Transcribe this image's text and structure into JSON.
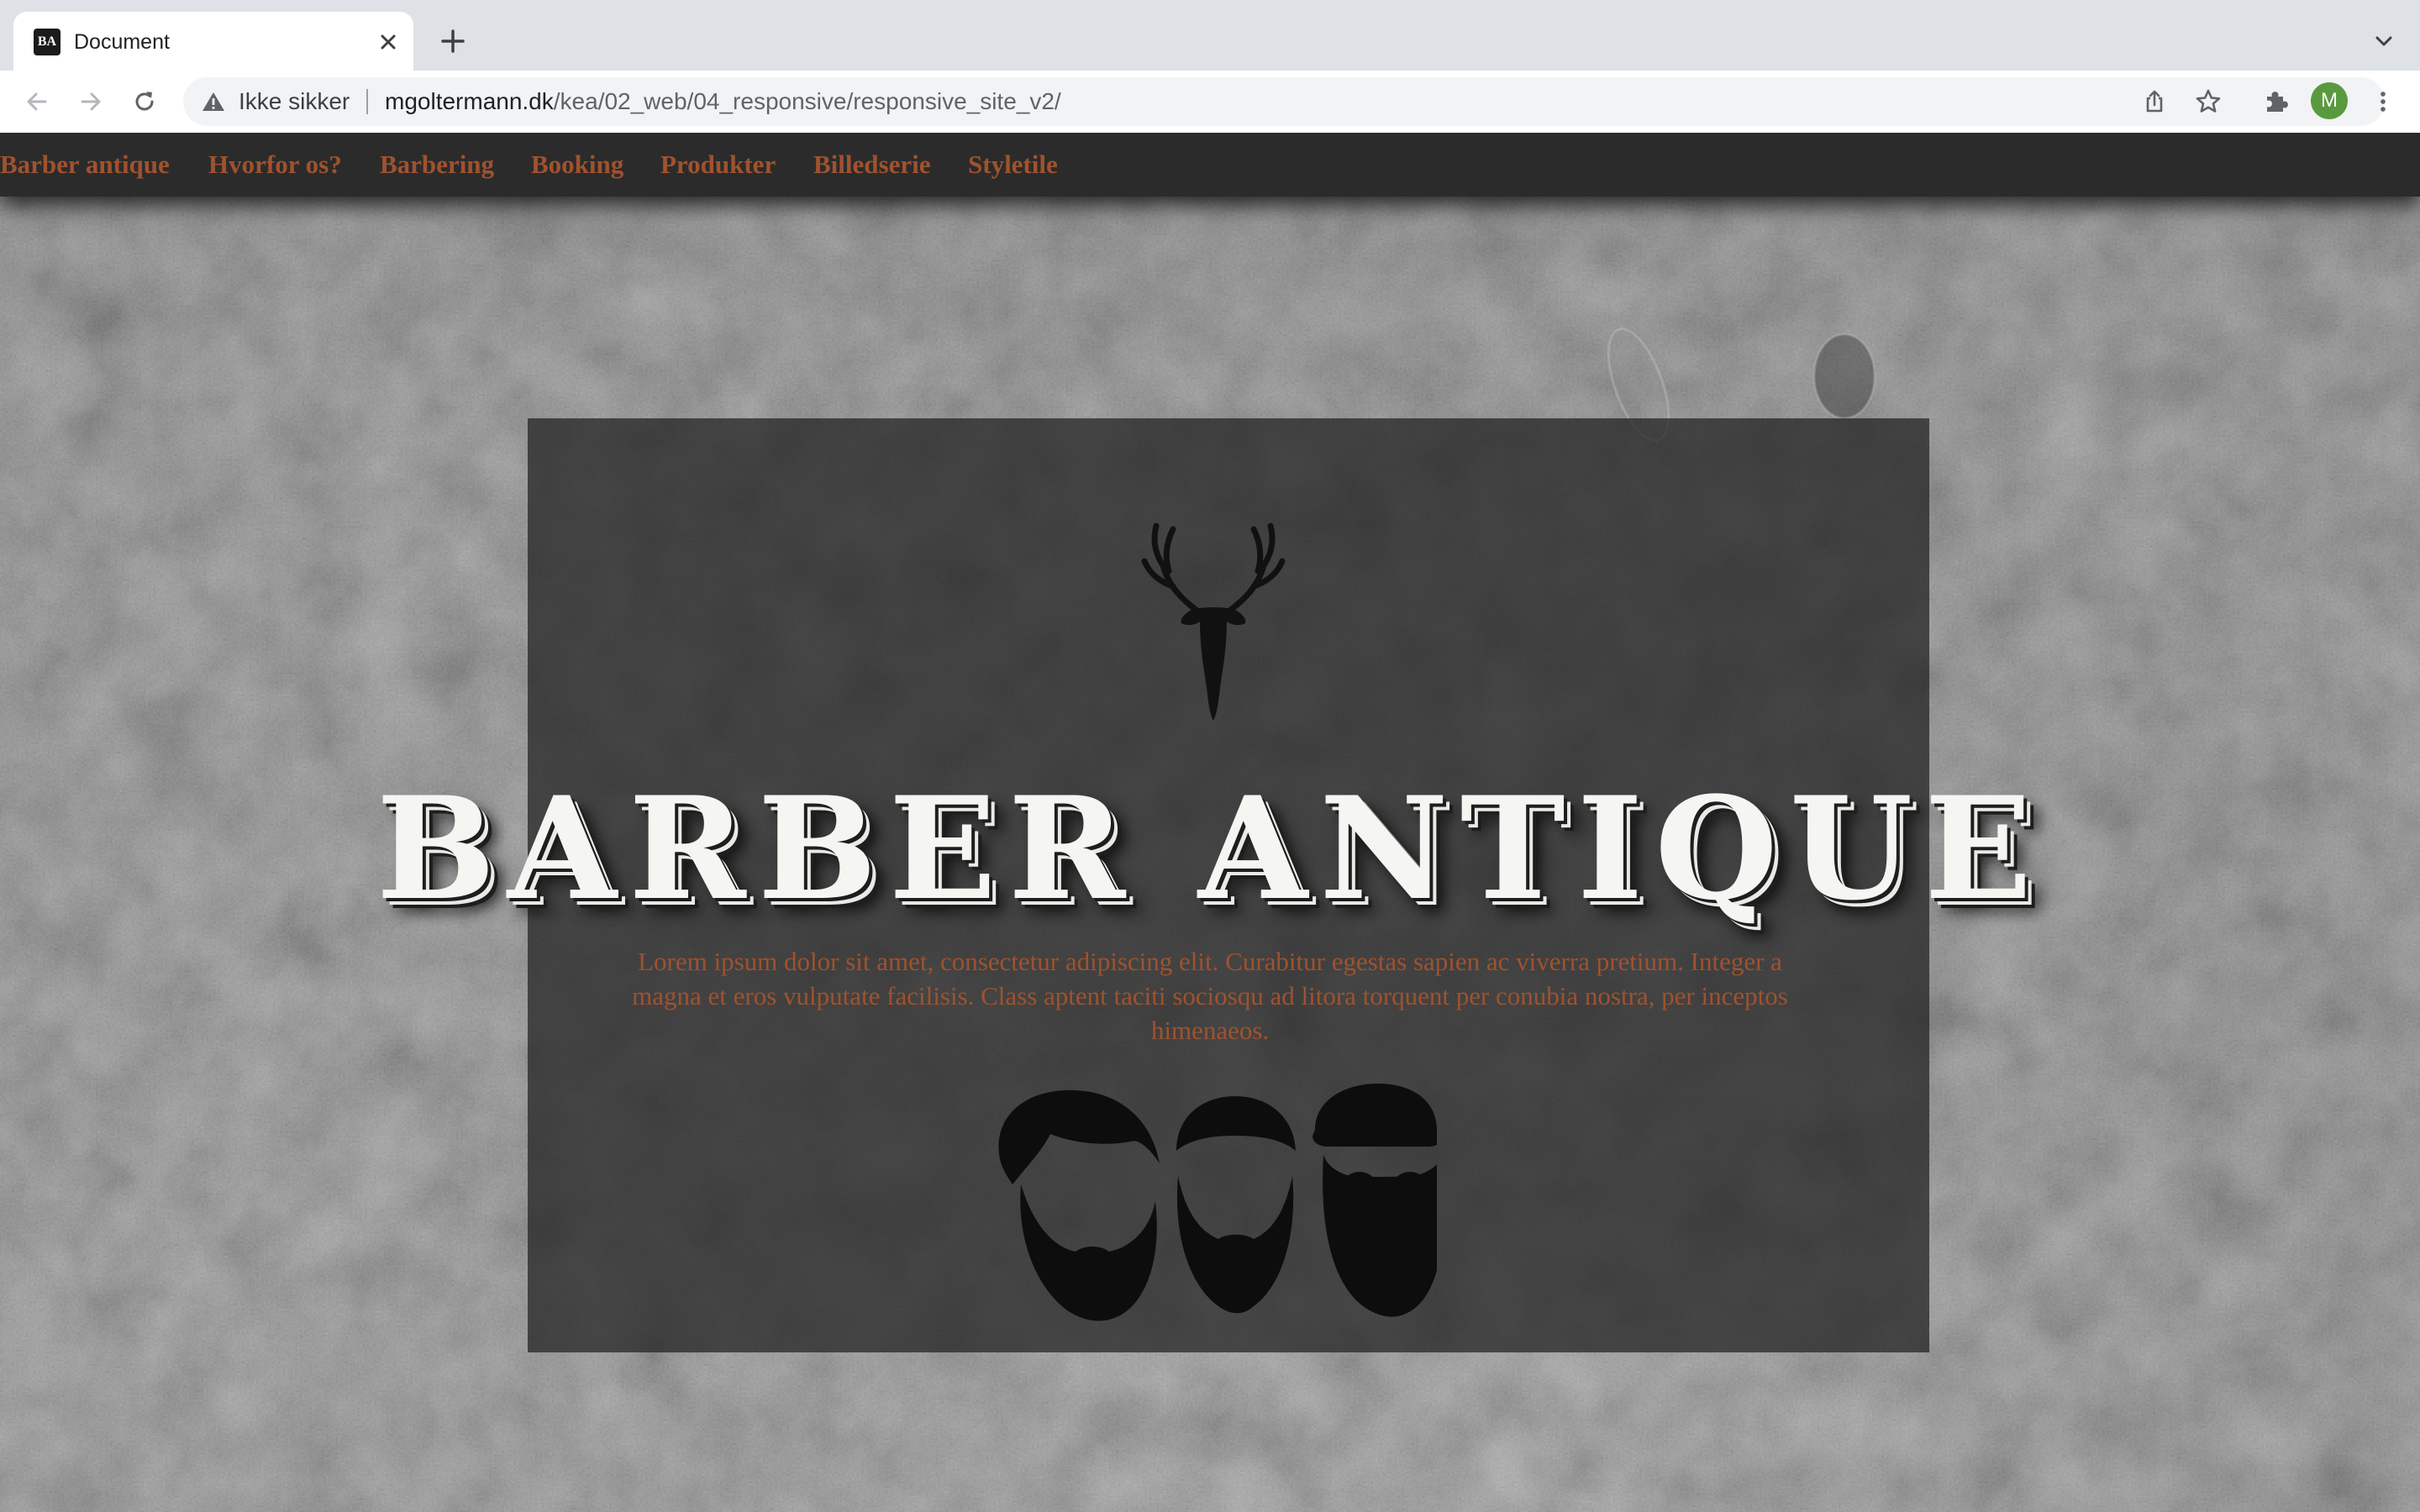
{
  "browser": {
    "tab": {
      "favicon_text": "BA",
      "title": "Document"
    },
    "omnibox": {
      "security_label": "Ikke sikker",
      "url_host": "mgoltermann.dk",
      "url_path": "/kea/02_web/04_responsive/responsive_site_v2/"
    },
    "profile_initial": "M",
    "icons": {
      "back": "arrow-left-icon",
      "forward": "arrow-right-icon",
      "reload": "reload-icon",
      "security": "warning-triangle-icon",
      "share": "share-icon",
      "bookmark": "star-icon",
      "extensions": "puzzle-icon",
      "menu": "kebab-menu-icon",
      "close_tab": "close-icon",
      "new_tab": "plus-icon",
      "tab_search": "chevron-down-icon"
    }
  },
  "site": {
    "nav": [
      {
        "label": "Barber antique"
      },
      {
        "label": "Hvorfor os?"
      },
      {
        "label": "Barbering"
      },
      {
        "label": "Booking"
      },
      {
        "label": "Produkter"
      },
      {
        "label": "Billedserie"
      },
      {
        "label": "Styletile"
      }
    ],
    "hero": {
      "title": "BARBER ANTIQUE",
      "text": "Lorem ipsum dolor sit amet, consectetur adipiscing elit. Curabitur egestas sapien ac viverra pretium. Integer a magna et eros vulputate facilisis. Class aptent taciti sociosqu ad litora torquent per conubia nostra, per inceptos himenaeos."
    },
    "colors": {
      "accent": "#a0522d",
      "nav_background": "#2b2b2b",
      "title": "#f5f5f2"
    }
  }
}
